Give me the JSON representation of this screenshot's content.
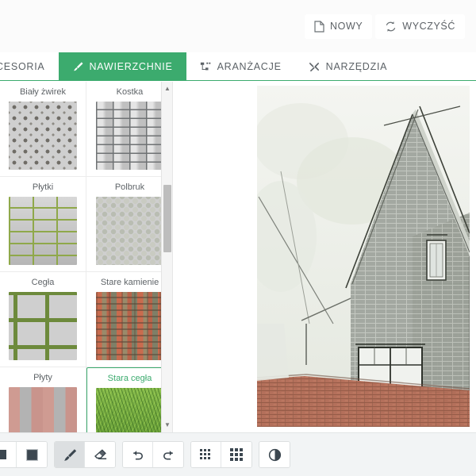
{
  "topbar": {
    "buttons": [
      {
        "label": "NOWY",
        "icon": "document-icon"
      },
      {
        "label": "WYCZYŚĆ",
        "icon": "refresh-icon"
      }
    ]
  },
  "tabs": [
    {
      "label": "CESORIA",
      "icon": "",
      "active": false,
      "partial": true
    },
    {
      "label": "NAWIERZCHNIE",
      "icon": "brush-icon",
      "active": true,
      "partial": false
    },
    {
      "label": "ARANŻACJE",
      "icon": "hierarchy-icon",
      "active": false,
      "partial": false
    },
    {
      "label": "NARZĘDZIA",
      "icon": "tools-icon",
      "active": false,
      "partial": false
    }
  ],
  "texture_panel": {
    "items": [
      {
        "label": "Biały żwirek",
        "pattern": "tx-bialy-zwirek",
        "selected": false
      },
      {
        "label": "Kostka",
        "pattern": "tx-kostka",
        "selected": false
      },
      {
        "label": "Płytki",
        "pattern": "tx-plytki",
        "selected": false
      },
      {
        "label": "Polbruk",
        "pattern": "tx-polbruk",
        "selected": false
      },
      {
        "label": "Cegła",
        "pattern": "tx-cegla",
        "selected": false
      },
      {
        "label": "Stare kamienie",
        "pattern": "tx-stare-kamienie",
        "selected": false
      },
      {
        "label": "Płyty",
        "pattern": "tx-plyty",
        "selected": false
      },
      {
        "label": "Stara cegła",
        "pattern": "tx-trawa",
        "selected": true
      }
    ],
    "scrollbar": {
      "up_arrow": "▲",
      "down_arrow": "▼"
    }
  },
  "bottom_toolbar": {
    "groups": [
      {
        "tools": [
          {
            "name": "color-swatch-partial-button",
            "icon": "square-icon",
            "active": false
          },
          {
            "name": "fill-color-button",
            "icon": "filled-square-icon",
            "active": false
          }
        ]
      },
      {
        "tools": [
          {
            "name": "brush-tool-button",
            "icon": "brush-icon",
            "active": true
          },
          {
            "name": "eraser-tool-button",
            "icon": "eraser-icon",
            "active": false
          }
        ]
      },
      {
        "tools": [
          {
            "name": "undo-button",
            "icon": "undo-icon",
            "active": false
          },
          {
            "name": "redo-button",
            "icon": "redo-icon",
            "active": false
          }
        ]
      },
      {
        "tools": [
          {
            "name": "grid-fine-button",
            "icon": "grid-fine-icon",
            "active": false
          },
          {
            "name": "grid-coarse-button",
            "icon": "grid-coarse-icon",
            "active": false
          }
        ]
      },
      {
        "tools": [
          {
            "name": "contrast-button",
            "icon": "contrast-icon",
            "active": false
          }
        ]
      }
    ]
  },
  "colors": {
    "accent_green": "#3cab6e",
    "toolbar_bg": "#f2f4f5",
    "panel_border": "#e6e6e6",
    "text_muted": "#5c6166",
    "scrollbar_thumb": "#bdbdbd",
    "canvas_sky": "#eef0ea",
    "canvas_brick_wall": "#9fa49d",
    "canvas_patio": "#b9705a"
  },
  "canvas": {
    "description": "architectural sketch rendering of a house with gable roof and brick patio"
  }
}
